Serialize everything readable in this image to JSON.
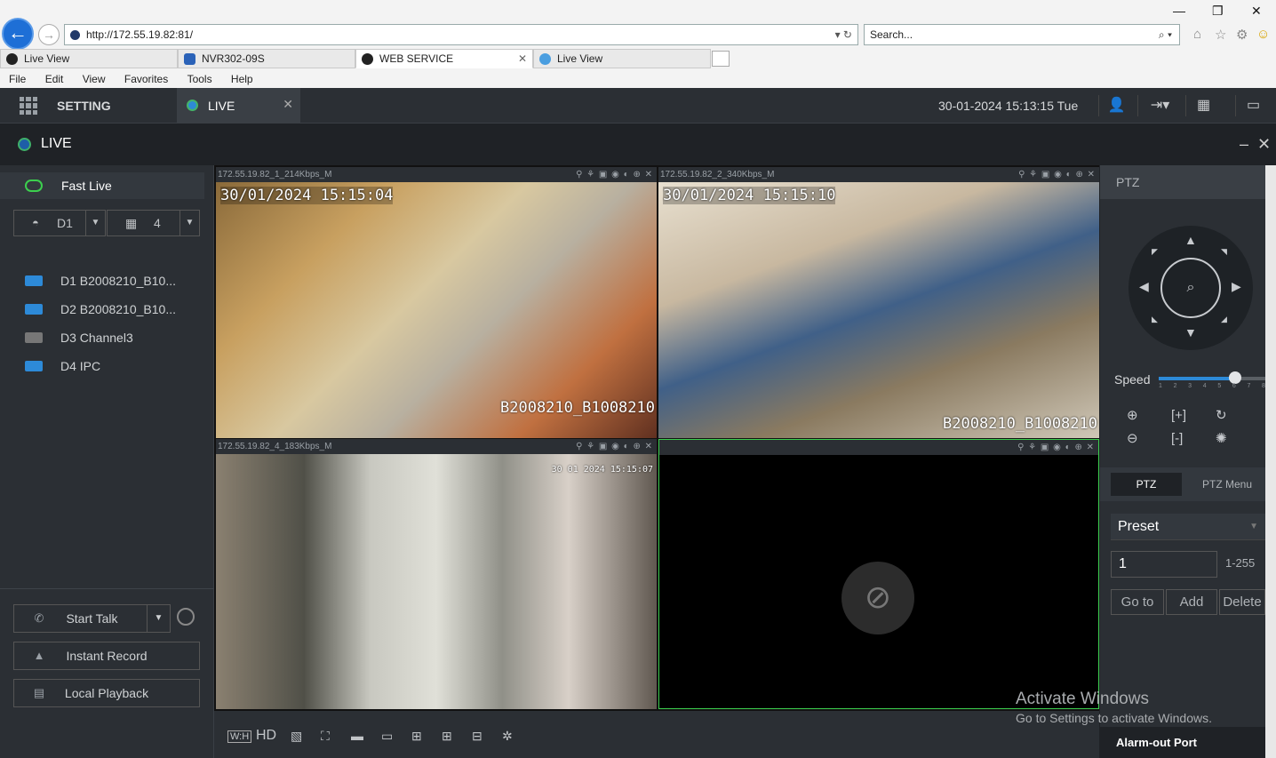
{
  "browser": {
    "url": "http://172.55.19.82:81/",
    "search_placeholder": "Search...",
    "tabs": [
      {
        "label": "Live View"
      },
      {
        "label": "NVR302-09S"
      },
      {
        "label": "WEB SERVICE"
      },
      {
        "label": "Live View"
      }
    ],
    "menu": [
      "File",
      "Edit",
      "View",
      "Favorites",
      "Tools",
      "Help"
    ]
  },
  "app": {
    "setting_label": "SETTING",
    "live_tab_label": "LIVE",
    "datetime": "30-01-2024 15:13:15 Tue",
    "page_title": "LIVE"
  },
  "sidebar": {
    "fast_live": "Fast Live",
    "stream_select": "D1",
    "layout_select": "4",
    "devices": [
      {
        "label": "D1 B2008210_B10...",
        "active": true
      },
      {
        "label": "D2 B2008210_B10...",
        "active": true
      },
      {
        "label": "D3 Channel3",
        "active": false
      },
      {
        "label": "D4 IPC",
        "active": true
      }
    ],
    "start_talk": "Start Talk",
    "instant_record": "Instant Record",
    "local_playback": "Local Playback"
  },
  "panes": [
    {
      "title": "172.55.19.82_1_214Kbps_M",
      "osd_time": "30/01/2024 15:15:04",
      "osd_name": "B2008210_B1008210"
    },
    {
      "title": "172.55.19.82_2_340Kbps_M",
      "osd_time": "30/01/2024 15:15:10",
      "osd_name": "B2008210_B1008210"
    },
    {
      "title": "172.55.19.82_4_183Kbps_M",
      "osd_time": "30 01 2024 15:15:07",
      "osd_name": ""
    },
    {
      "title": "",
      "osd_time": "",
      "osd_name": ""
    }
  ],
  "video_toolbar": {
    "hd_label": "HD"
  },
  "ptz": {
    "header": "PTZ",
    "speed_label": "Speed",
    "speed_value": 6,
    "speed_ticks": [
      "1",
      "2",
      "3",
      "4",
      "5",
      "6",
      "7",
      "8"
    ],
    "tab_ptz": "PTZ",
    "tab_menu": "PTZ Menu",
    "preset_label": "Preset",
    "preset_number": "1",
    "preset_range": "1-255",
    "goto": "Go to",
    "add": "Add",
    "delete": "Delete",
    "alarm_out": "Alarm-out Port"
  },
  "watermark": {
    "line1": "Activate Windows",
    "line2": "Go to Settings to activate Windows."
  },
  "colors": {
    "accent": "#2d8ad8",
    "active_border": "#3ccf4e",
    "live_green": "#44b36a"
  }
}
